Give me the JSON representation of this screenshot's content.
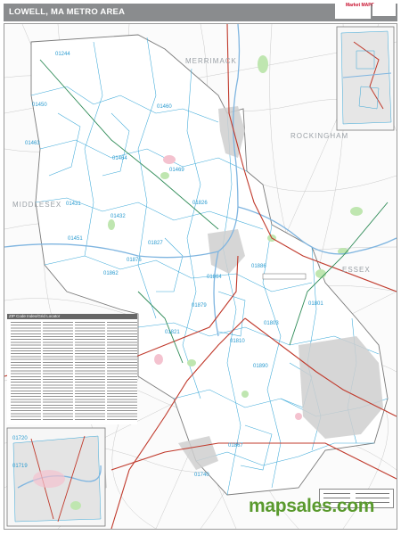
{
  "header": {
    "title": "LOWELL, MA METRO AREA"
  },
  "logo": {
    "brand": "Market MAPS"
  },
  "places": [
    {
      "name": "MERRIMACK"
    },
    {
      "name": "ROCKINGHAM"
    },
    {
      "name": "ESSEX"
    },
    {
      "name": "MIDDLESEX"
    }
  ],
  "zip_labels": [
    "01244",
    "01450",
    "01460",
    "01463",
    "01464",
    "01469",
    "01431",
    "01432",
    "01451",
    "01826",
    "01827",
    "01876",
    "01862",
    "01864",
    "01886",
    "01879",
    "01821",
    "01810",
    "01803",
    "01890",
    "01801",
    "01867",
    "01740",
    "01720",
    "01719",
    "01742",
    "01773",
    "01863",
    "01460",
    "01843",
    "01844",
    "01824",
    "01827"
  ],
  "index": {
    "title": "ZIP Code Index/Grid Locator"
  },
  "footer": {
    "brand": "mapsales.com"
  },
  "colors": {
    "title_bar": "#8a8c8e",
    "zip_boundary": "#3aa8d8",
    "county_outline": "#777777",
    "urban": "#c8c8c8",
    "park": "#bfe6b0",
    "water": "#9cc7e8",
    "interstate": "#c0392b",
    "brand_green": "#5a9a2e"
  }
}
